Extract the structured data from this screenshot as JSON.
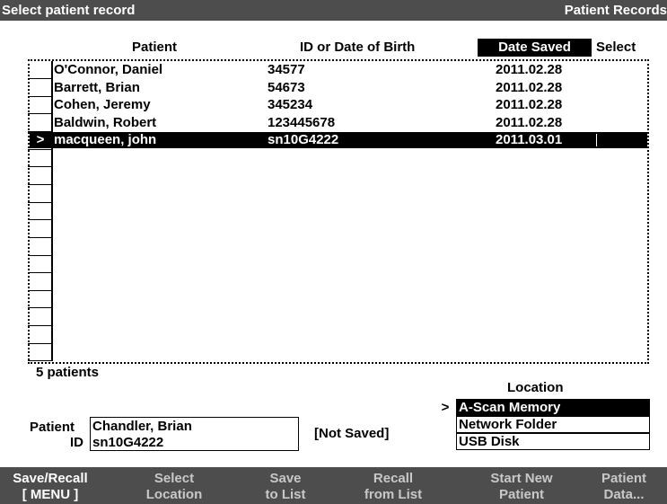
{
  "title_left": "Select patient record",
  "title_right": "Patient Records",
  "columns": {
    "patient": "Patient",
    "id": "ID or Date of Birth",
    "date": "Date Saved",
    "select": "Select"
  },
  "rows": [
    {
      "marker": "",
      "name": "O'Connor, Daniel",
      "id": "34577",
      "date": "2011.02.28"
    },
    {
      "marker": "",
      "name": "Barrett, Brian",
      "id": "54673",
      "date": "2011.02.28"
    },
    {
      "marker": "",
      "name": "Cohen, Jeremy",
      "id": "345234",
      "date": "2011.02.28"
    },
    {
      "marker": "",
      "name": "Baldwin, Robert",
      "id": "123445678",
      "date": "2011.02.28"
    },
    {
      "marker": ">",
      "name": "macqueen, john",
      "id": "sn10G4222",
      "date": "2011.03.01"
    }
  ],
  "selected_row": 4,
  "count_text": "5 patients",
  "location": {
    "label": "Location",
    "options": [
      {
        "marker": ">",
        "label": "A-Scan Memory",
        "active": true
      },
      {
        "marker": "",
        "label": "Network Folder",
        "active": false
      },
      {
        "marker": "",
        "label": "USB Disk",
        "active": false
      }
    ]
  },
  "current": {
    "patient_label": "Patient",
    "patient_value": "Chandler, Brian",
    "id_label": "ID",
    "id_value": "sn10G4222",
    "status": "[Not Saved]"
  },
  "softkeys": [
    {
      "line1": "Save/Recall",
      "line2": "[ MENU ]",
      "active": true
    },
    {
      "line1": "Select",
      "line2": "Location",
      "active": false
    },
    {
      "line1": "Save",
      "line2": "to List",
      "active": false
    },
    {
      "line1": "Recall",
      "line2": "from List",
      "active": false
    },
    {
      "line1": "Start New",
      "line2": "Patient",
      "active": false
    },
    {
      "line1": "Patient",
      "line2": "Data...",
      "active": false
    }
  ]
}
